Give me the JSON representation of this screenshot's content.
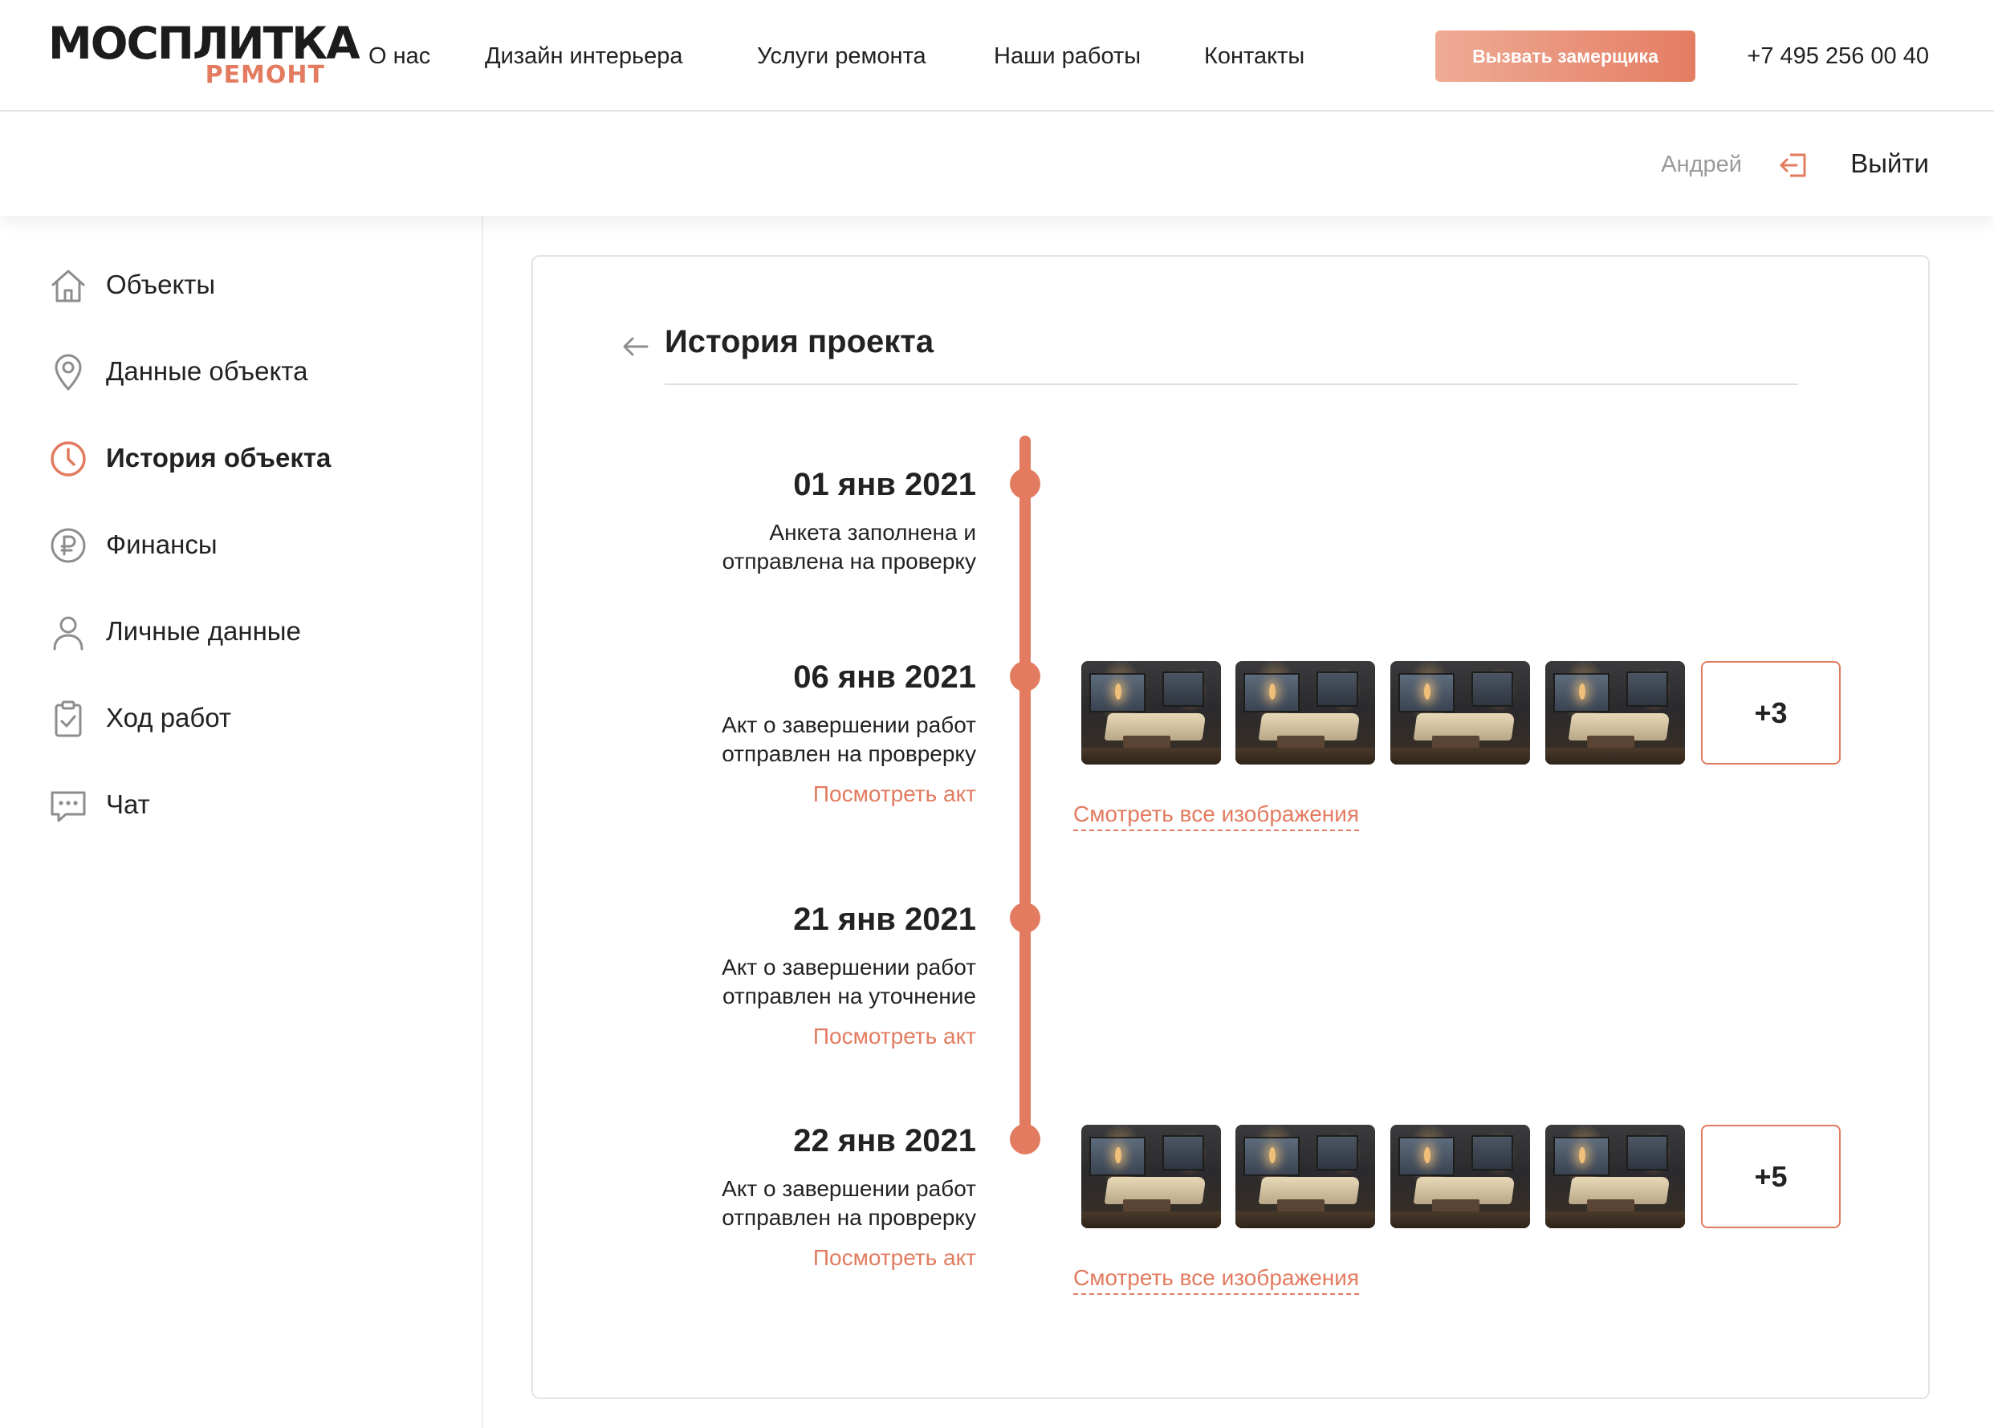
{
  "header": {
    "logo_main": "МОСПЛИТКА",
    "logo_sub": "РЕМОНТ",
    "nav": [
      "О нас",
      "Дизайн интерьера",
      "Услуги ремонта",
      "Наши работы",
      "Контакты"
    ],
    "cta_label": "Вызвать замерщика",
    "phone": "+7 495 256 00 40"
  },
  "userbar": {
    "username": "Андрей",
    "logout_label": "Выйти",
    "logout_icon": "logout-icon"
  },
  "sidebar": {
    "items": [
      {
        "label": "Объекты",
        "icon": "home-icon",
        "active": false
      },
      {
        "label": "Данные объекта",
        "icon": "location-pin-icon",
        "active": false
      },
      {
        "label": "История объекта",
        "icon": "clock-icon",
        "active": true
      },
      {
        "label": "Финансы",
        "icon": "ruble-icon",
        "active": false
      },
      {
        "label": "Личные данные",
        "icon": "user-icon",
        "active": false
      },
      {
        "label": "Ход работ",
        "icon": "clipboard-check-icon",
        "active": false
      },
      {
        "label": "Чат",
        "icon": "chat-icon",
        "active": false
      }
    ]
  },
  "main": {
    "title": "История проекта",
    "events": [
      {
        "date": "01 янв 2021",
        "description": "Анкета заполнена и\nотправлена на проверку",
        "link": "",
        "photos_count": 0,
        "more_label": "",
        "all_images_label": ""
      },
      {
        "date": "06 янв 2021",
        "description": "Акт о завершении работ\nотправлен на проврерку",
        "link": "Посмотреть акт",
        "photos_count": 4,
        "more_label": "+3",
        "all_images_label": "Смотреть все изображения"
      },
      {
        "date": "21 янв 2021",
        "description": "Акт о завершении работ\nотправлен на уточнение",
        "link": "Посмотреть акт",
        "photos_count": 0,
        "more_label": "",
        "all_images_label": ""
      },
      {
        "date": "22 янв 2021",
        "description": "Акт о завершении работ\nотправлен на проврерку",
        "link": "Посмотреть акт",
        "photos_count": 4,
        "more_label": "+5",
        "all_images_label": "Смотреть все изображения"
      }
    ]
  },
  "colors": {
    "accent": "#e27b5f",
    "text": "#222222",
    "muted": "#9a9a9a",
    "border": "#e3e3e3"
  }
}
